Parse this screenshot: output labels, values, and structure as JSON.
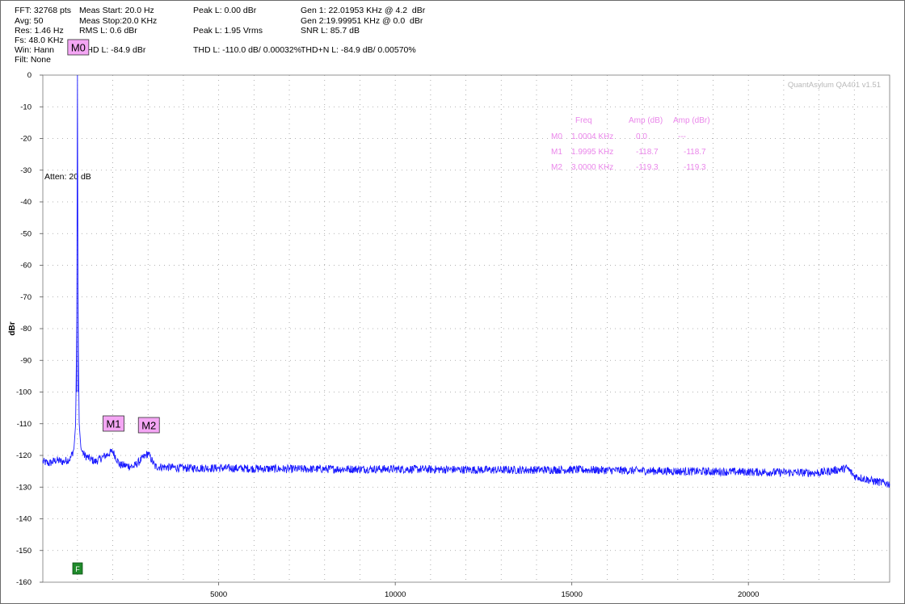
{
  "header": {
    "col1": [
      "FFT: 32768 pts",
      "Avg: 50",
      "Res: 1.46 Hz",
      "Fs: 48.0 KHz",
      "Win: Hann",
      "Filt: None"
    ],
    "col2": [
      "Meas Start: 20.0 Hz",
      "Meas Stop:20.0 KHz",
      "RMS L: 0.6 dBr"
    ],
    "thd_l": "THD L: -84.9 dBr",
    "peak_l_dbr": "Peak L: 0.00 dBr",
    "peak_l_vrms": "Peak L: 1.95 Vrms",
    "thd_l_pct": "THD L: -110.0 dB/ 0.00032%",
    "gen1": "Gen 1: 22.01953 KHz @ 4.2  dBr",
    "gen2": "Gen 2:19.99951 KHz @ 0.0  dBr",
    "snr_l": "SNR L: 85.7 dB",
    "thdn_l": "THD+N L: -84.9 dB/ 0.00570%"
  },
  "watermark": "QuantAsylum QA401 v1.51",
  "atten_label": "Atten: 20 dB",
  "f_marker_label": "F",
  "marker_table": {
    "headers": [
      "Freq",
      "Amp (dB)",
      "Amp (dBr)"
    ],
    "rows": [
      {
        "name": "M0",
        "freq": "1.0004 KHz",
        "amp_db": "0.0",
        "amp_dbr": "---"
      },
      {
        "name": "M1",
        "freq": "1.9995 KHz",
        "amp_db": "-118.7",
        "amp_dbr": "-118.7"
      },
      {
        "name": "M2",
        "freq": "3.0000 KHz",
        "amp_db": "-119.3",
        "amp_dbr": "-119.3"
      }
    ]
  },
  "colors": {
    "trace": "#1a1aff",
    "grid": "#9a9a9a",
    "marker_fill": "#f4a6f4",
    "table_text": "#ea86ea",
    "f_marker": "#1f8a2a"
  },
  "chart_data": {
    "type": "line",
    "title": "",
    "xlabel": "",
    "ylabel": "dBr",
    "xlim": [
      20,
      24000
    ],
    "ylim": [
      -160,
      0
    ],
    "x_ticks": [
      5000,
      10000,
      15000,
      20000
    ],
    "y_ticks": [
      0,
      -10,
      -20,
      -30,
      -40,
      -50,
      -60,
      -70,
      -80,
      -90,
      -100,
      -110,
      -120,
      -130,
      -140,
      -150,
      -160
    ],
    "grid": true,
    "series": [
      {
        "values_description_free": true,
        "points": [
          [
            20,
            -122
          ],
          [
            200,
            -122.5
          ],
          [
            400,
            -121.5
          ],
          [
            600,
            -122
          ],
          [
            800,
            -121
          ],
          [
            900,
            -118
          ],
          [
            950,
            -110
          ],
          [
            980,
            -80
          ],
          [
            995,
            -30
          ],
          [
            1000.4,
            0
          ],
          [
            1005,
            -30
          ],
          [
            1020,
            -80
          ],
          [
            1050,
            -110
          ],
          [
            1100,
            -118
          ],
          [
            1200,
            -120
          ],
          [
            1500,
            -122
          ],
          [
            1999.5,
            -118.7
          ],
          [
            2200,
            -123
          ],
          [
            2600,
            -123.5
          ],
          [
            3000,
            -119.3
          ],
          [
            3200,
            -123.5
          ],
          [
            4000,
            -124
          ],
          [
            5000,
            -124
          ],
          [
            7000,
            -124.3
          ],
          [
            10000,
            -124.3
          ],
          [
            13000,
            -124.6
          ],
          [
            15000,
            -124.5
          ],
          [
            18000,
            -125
          ],
          [
            20000,
            -125.2
          ],
          [
            22000,
            -125.5
          ],
          [
            22800,
            -124
          ],
          [
            23000,
            -126.5
          ],
          [
            23500,
            -128
          ],
          [
            24000,
            -129
          ]
        ]
      }
    ],
    "markers": [
      {
        "name": "M0",
        "x": 1000.4,
        "y": 0
      },
      {
        "name": "M1",
        "x": 1999.5,
        "y": -118.7
      },
      {
        "name": "M2",
        "x": 3000.0,
        "y": -119.3
      }
    ]
  }
}
